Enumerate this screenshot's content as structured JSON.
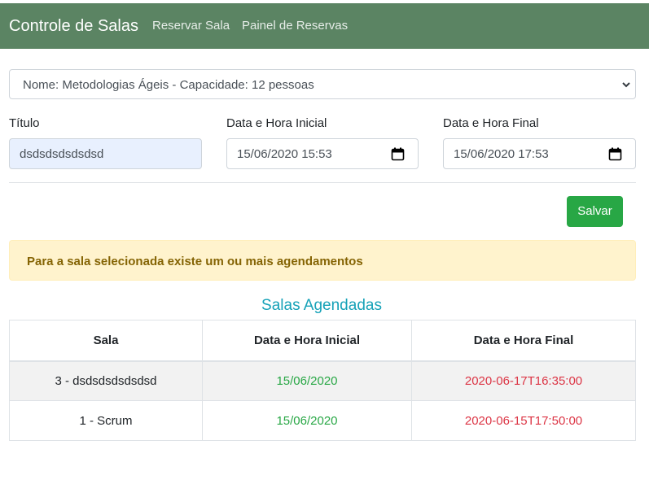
{
  "navbar": {
    "brand": "Controle de Salas",
    "links": [
      "Reservar Sala",
      "Painel de Reservas"
    ],
    "color": "#5b8463"
  },
  "form": {
    "room_select_value": "Nome: Metodologias Ágeis - Capacidade: 12 pessoas",
    "title_label": "Título",
    "title_value": "dsdsdsdsdsdsd",
    "start_label": "Data e Hora Inicial",
    "start_value": "15/06/2020 15:53",
    "end_label": "Data e Hora Final",
    "end_value": "15/06/2020 17:53",
    "save_label": "Salvar"
  },
  "alert": {
    "message": "Para a sala selecionada existe um ou mais agendamentos",
    "color": "#856404"
  },
  "schedule": {
    "title": "Salas Agendadas",
    "headers": [
      "Sala",
      "Data e Hora Inicial",
      "Data e Hora Final"
    ],
    "rows": [
      {
        "room": "3 - dsdsdsdsdsdsd",
        "start": "15/06/2020",
        "end": "2020-06-17T16:35:00"
      },
      {
        "room": "1 - Scrum",
        "start": "15/06/2020",
        "end": "2020-06-15T17:50:00"
      }
    ],
    "start_color": "#28a745",
    "end_color": "#dc3545"
  }
}
